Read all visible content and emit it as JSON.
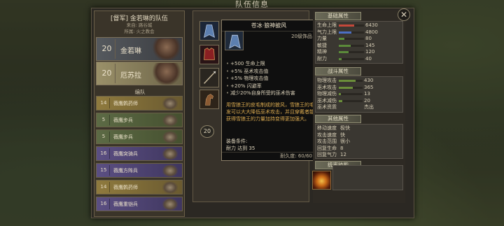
{
  "window": {
    "title": "队伍信息",
    "close": "✕"
  },
  "party": {
    "name": "[督军] 金若琳的队伍",
    "origin": "来自: 路谷城",
    "faction": "所属: 火之教会",
    "heroes": [
      {
        "level": "20",
        "name": "金若琳"
      },
      {
        "level": "20",
        "name": "厄苏拉"
      }
    ],
    "squad_label": "编队",
    "units": [
      {
        "level": "14",
        "name": "薇鹰鹘药师",
        "color": "orange"
      },
      {
        "level": "5",
        "name": "薇鹰步兵",
        "color": "green"
      },
      {
        "level": "5",
        "name": "薇鹰步兵",
        "color": "green"
      },
      {
        "level": "16",
        "name": "薇鹰突骑兵",
        "color": "purple"
      },
      {
        "level": "15",
        "name": "薇鹰方阵兵",
        "color": "purple"
      },
      {
        "level": "14",
        "name": "薇鹰鹘药师",
        "color": "orange"
      },
      {
        "level": "16",
        "name": "薇鹰重铠兵",
        "color": "purple"
      }
    ]
  },
  "gear": {
    "level_badge": "20",
    "slots": [
      "cloak-icon",
      "armor-icon",
      "spear-icon",
      "horse-icon"
    ]
  },
  "tooltip": {
    "title": "苍冰·狼神披风",
    "tier": "20级饰品",
    "stats": [
      "+500 生命上限",
      "+5% 巫术攻击值",
      "+5% 物理攻击值",
      "+20% 闪避率",
      "减少20%自身所受的巫术伤害"
    ],
    "description": "用雪狼王的皮毛制成的披风，雪狼王的毛发可以大大降低巫术攻击，并且穿戴者能获得雪狼王的力量加持变得更加强大。",
    "requirement_label": "装备条件:",
    "requirement": "耐力 达到 35",
    "durability": "耐久度: 60/60"
  },
  "stats": {
    "basic_title": "基础属性",
    "basic": [
      {
        "label": "生命上限",
        "value": "6430",
        "fill": 0.62,
        "color": "#c4483a"
      },
      {
        "label": "气力上限",
        "value": "4800",
        "fill": 0.5,
        "color": "#4c6fc4"
      },
      {
        "label": "力量",
        "value": "80",
        "fill": 0.22,
        "color": "#5b8a3a"
      },
      {
        "label": "敏捷",
        "value": "145",
        "fill": 0.48,
        "color": "#5b8a3a"
      },
      {
        "label": "精神",
        "value": "120",
        "fill": 0.4,
        "color": "#5b8a3a"
      },
      {
        "label": "耐力",
        "value": "40",
        "fill": 0.12,
        "color": "#5b8a3a"
      }
    ],
    "combat_title": "战斗属性",
    "combat": [
      {
        "label": "物理攻击",
        "value": "430",
        "fill": 0.7
      },
      {
        "label": "巫术攻击",
        "value": "365",
        "fill": 0.6
      },
      {
        "label": "物理减伤",
        "value": "13",
        "fill": 0.1
      },
      {
        "label": "巫术减伤",
        "value": "20",
        "fill": 0.16
      },
      {
        "label": "巫术资质",
        "value": "杰出",
        "fill": 0
      }
    ],
    "other_title": "其他属性",
    "other": [
      {
        "label": "移动速度",
        "value": "极快"
      },
      {
        "label": "攻击速度",
        "value": "快"
      },
      {
        "label": "攻击范围",
        "value": "很小"
      },
      {
        "label": "回复生命",
        "value": "8"
      },
      {
        "label": "回复气力",
        "value": "12"
      }
    ],
    "skill_title": "统率技能",
    "skill_icon": "fire-bird-icon"
  }
}
